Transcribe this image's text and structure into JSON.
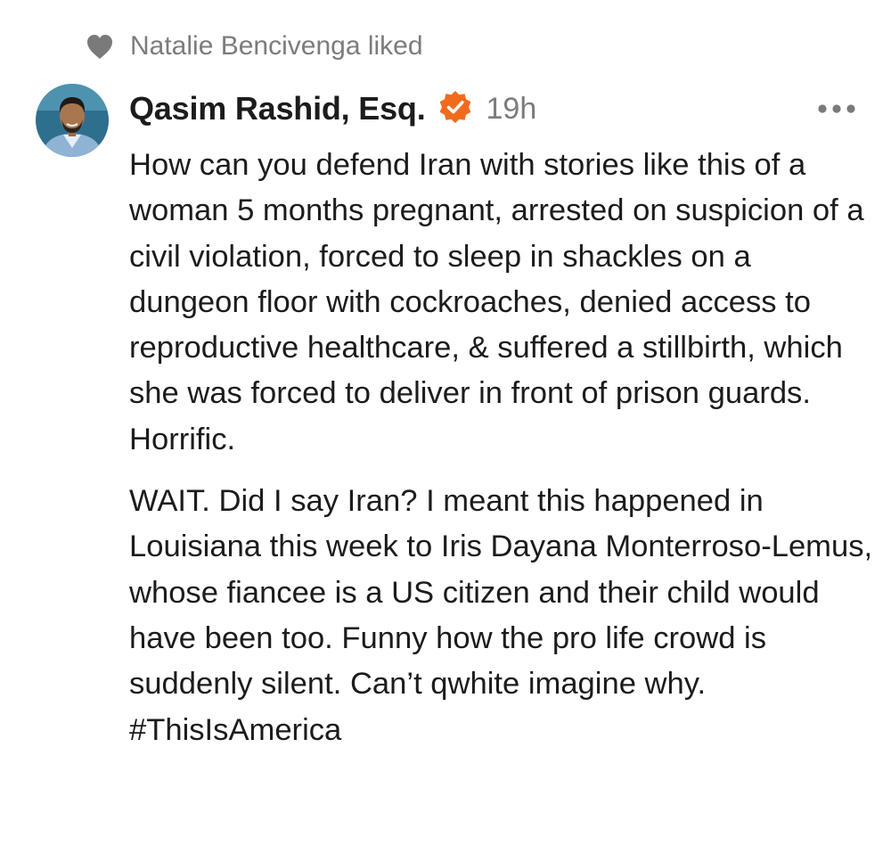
{
  "activity": {
    "icon": "heart-icon",
    "text": "Natalie Bencivenga liked"
  },
  "post": {
    "author": {
      "name": "Qasim Rashid, Esq.",
      "verified": true,
      "verified_icon": "verified-badge-icon",
      "avatar_icon": "avatar"
    },
    "timestamp": "19h",
    "more_icon": "ellipsis-icon",
    "body": [
      "How can you defend Iran with stories like this of a woman 5 months pregnant, arrested on suspicion of a civil violation, forced to sleep in shackles on a dungeon floor with cockroaches, denied access to reproductive healthcare, & suffered a stillbirth, which she was forced to deliver in front of prison guards. Horrific.",
      "WAIT. Did I say Iran? I meant this happened in Louisiana this week to Iris Dayana Monterroso-Lemus, whose fiancee is a US citizen and their child would have been too. Funny how the pro life crowd is suddenly silent. Can’t qwhite imagine why. #ThisIsAmerica"
    ]
  },
  "colors": {
    "text_primary": "#1c1c1c",
    "text_secondary": "#7c7c7c",
    "heart": "#7a7a7a",
    "verified_badge": "#f26b1d",
    "avatar_background": "#2f6f8e"
  }
}
